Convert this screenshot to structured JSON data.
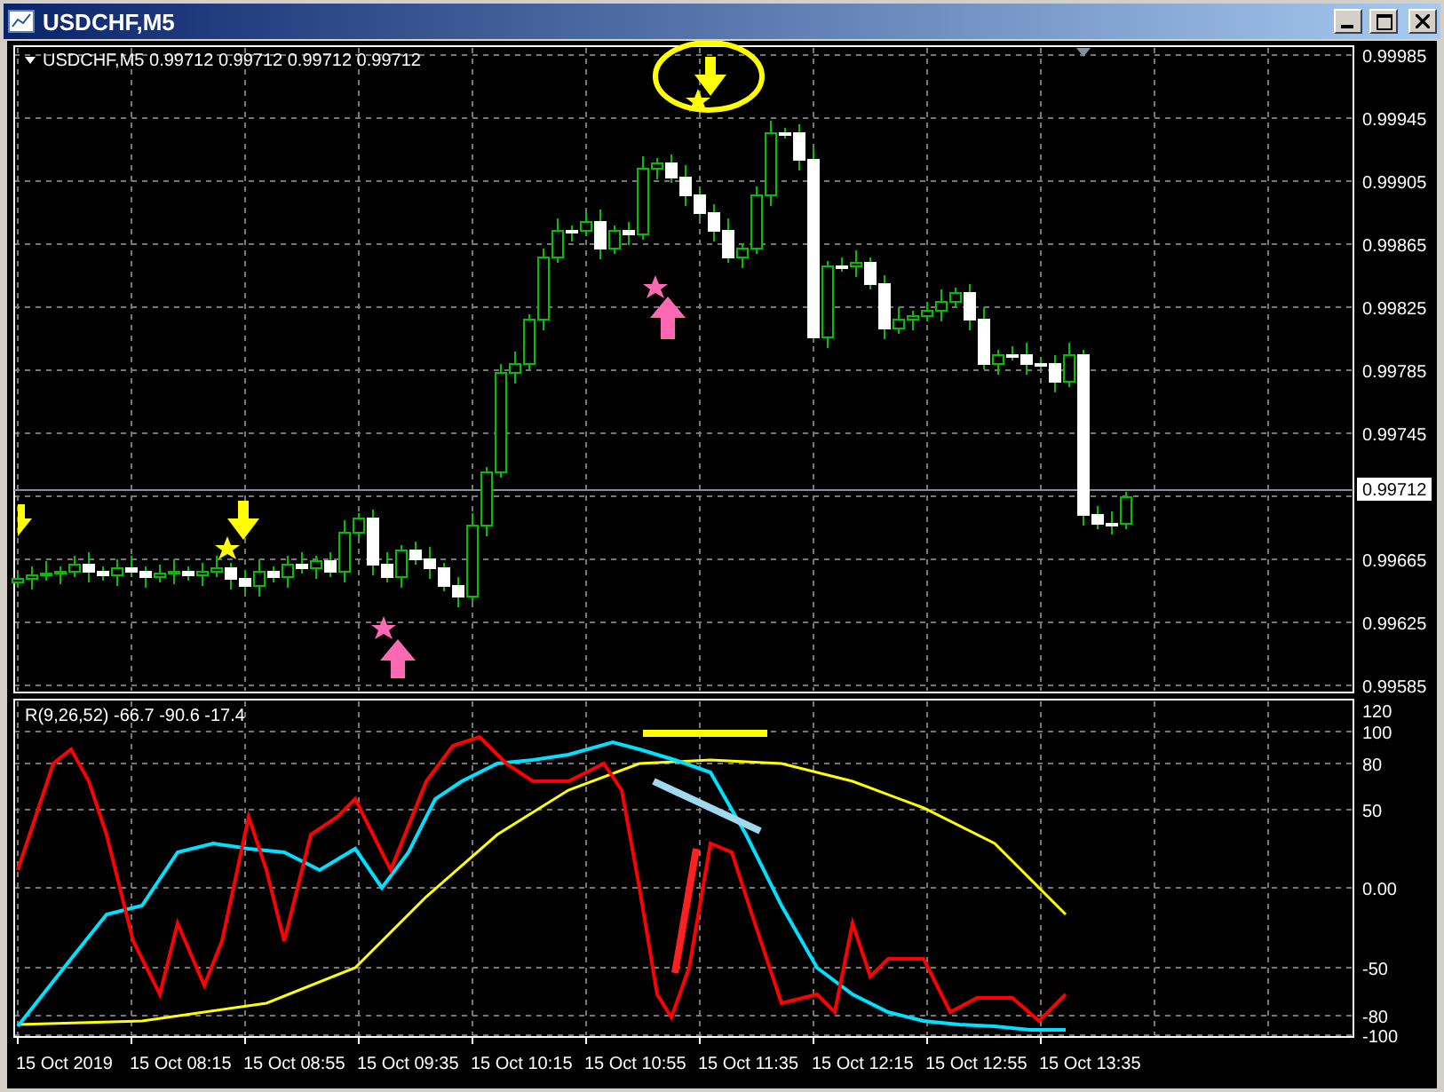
{
  "window": {
    "title": "USDCHF,M5"
  },
  "chart": {
    "symbol": "USDCHF,M5",
    "quotes": [
      "0.99712",
      "0.99712",
      "0.99712",
      "0.99712"
    ],
    "current_price": "0.99712",
    "price_axis": [
      "0.99985",
      "0.99945",
      "0.99905",
      "0.99865",
      "0.99825",
      "0.99785",
      "0.99745",
      "0.99665",
      "0.99625",
      "0.99585"
    ],
    "indicator": {
      "label": "R(9,26,52) -66.7 -90.6 -17.4",
      "axis": [
        "120",
        "100",
        "80",
        "50",
        "0.00",
        "-50",
        "-80",
        "-100"
      ]
    },
    "time_axis": [
      "15 Oct 2019",
      "15 Oct 08:15",
      "15 Oct 08:55",
      "15 Oct 09:35",
      "15 Oct 10:15",
      "15 Oct 10:55",
      "15 Oct 11:35",
      "15 Oct 12:15",
      "15 Oct 12:55",
      "15 Oct 13:35"
    ]
  }
}
